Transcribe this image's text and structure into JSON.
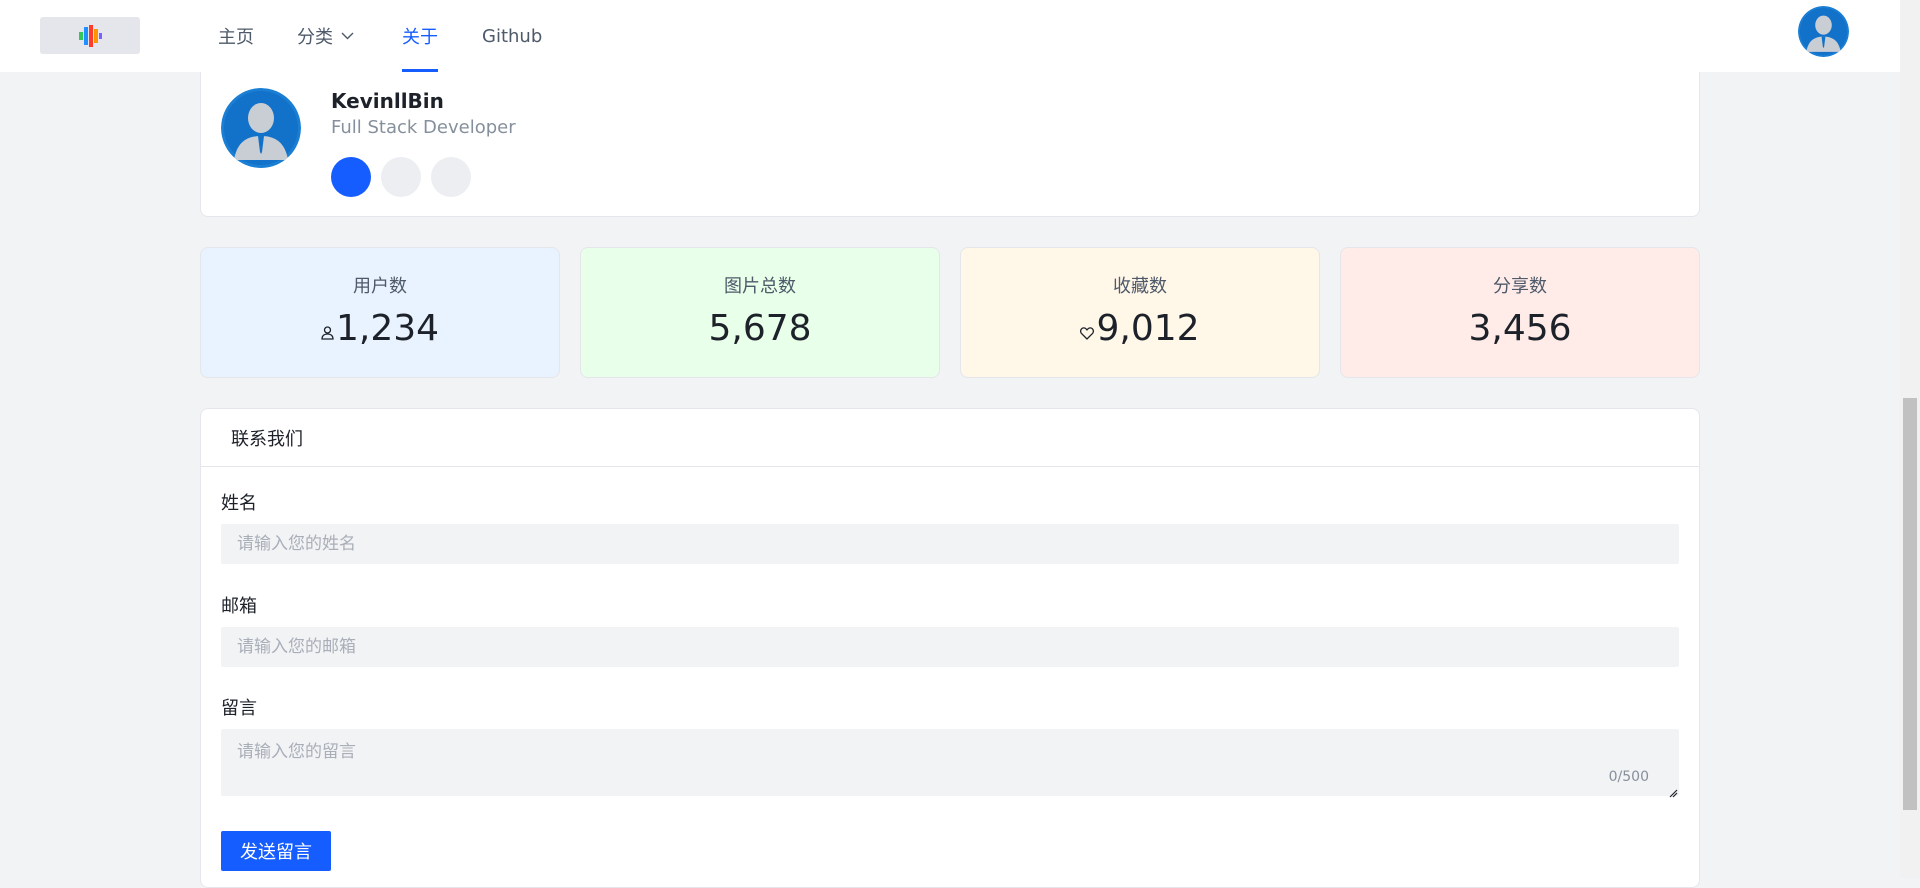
{
  "nav": {
    "items": [
      {
        "label": "主页"
      },
      {
        "label": "分类"
      },
      {
        "label": "关于"
      },
      {
        "label": "Github"
      }
    ]
  },
  "profile": {
    "name": "KevinllBin",
    "title": "Full Stack Developer"
  },
  "stats": [
    {
      "label": "用户数",
      "value": "1,234",
      "bg": "#e8f3ff",
      "icon": "user-icon"
    },
    {
      "label": "图片总数",
      "value": "5,678",
      "bg": "#e8ffea",
      "icon": ""
    },
    {
      "label": "收藏数",
      "value": "9,012",
      "bg": "#fff7e8",
      "icon": "heart-icon"
    },
    {
      "label": "分享数",
      "value": "3,456",
      "bg": "#ffece8",
      "icon": ""
    }
  ],
  "contact": {
    "heading": "联系我们",
    "name_label": "姓名",
    "name_placeholder": "请输入您的姓名",
    "email_label": "邮箱",
    "email_placeholder": "请输入您的邮箱",
    "message_label": "留言",
    "message_placeholder": "请输入您的留言",
    "counter": "0/500",
    "submit_label": "发送留言"
  },
  "colors": {
    "accent": "#165dff",
    "page_bg": "#f2f3f5"
  }
}
